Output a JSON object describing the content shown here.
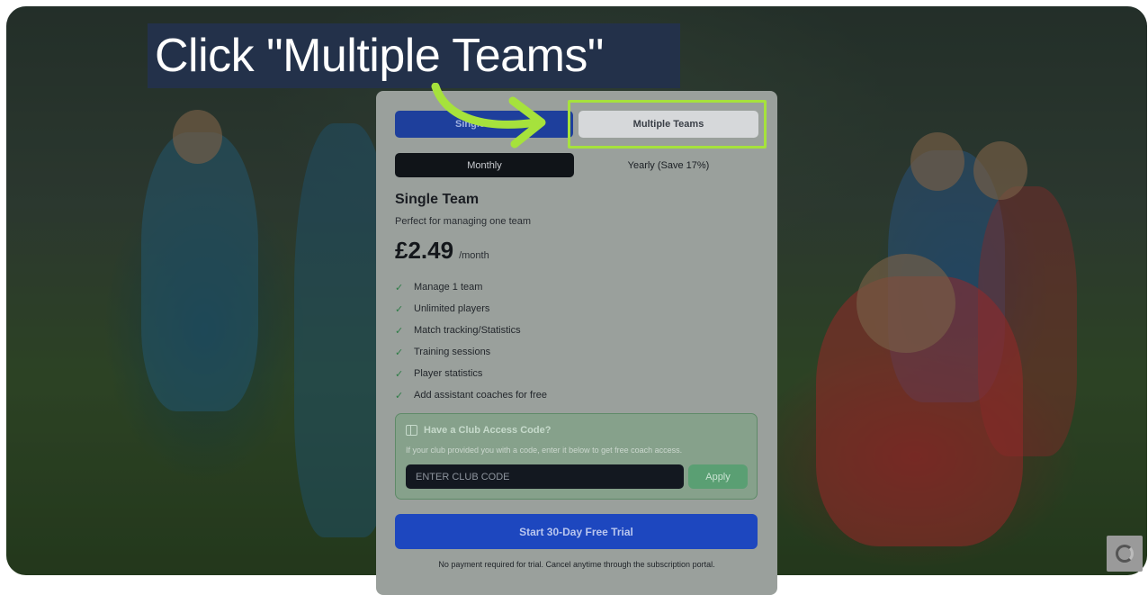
{
  "caption": {
    "text": "Click \"Multiple Teams\""
  },
  "pricing": {
    "team_toggle": {
      "single_label": "Single Team",
      "multiple_label": "Multiple Teams"
    },
    "billing_toggle": {
      "monthly_label": "Monthly",
      "yearly_label": "Yearly (Save 17%)"
    },
    "plan": {
      "title": "Single Team",
      "description": "Perfect for managing one team",
      "price": "£2.49",
      "period": "/month",
      "features": [
        "Manage 1 team",
        "Unlimited players",
        "Match tracking/Statistics",
        "Training sessions",
        "Player statistics",
        "Add assistant coaches for free"
      ]
    },
    "club_access": {
      "title": "Have a Club Access Code?",
      "description": "If your club provided you with a code, enter it below to get free coach access.",
      "input_placeholder": "ENTER CLUB CODE",
      "apply_label": "Apply"
    },
    "trial_button": "Start 30-Day Free Trial",
    "trial_note": "No payment required for trial. Cancel anytime through the subscription portal."
  },
  "colors": {
    "highlight": "#a6e23c",
    "primary": "#1d47bf",
    "caption_bg": "#23314a"
  }
}
